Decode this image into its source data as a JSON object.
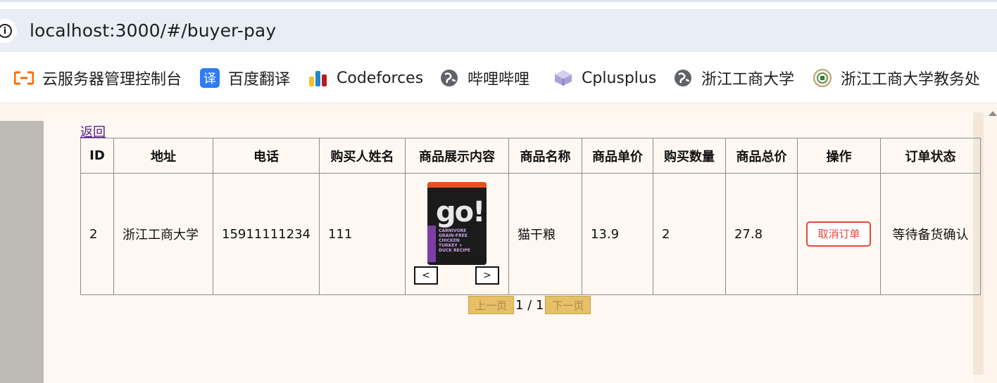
{
  "browser": {
    "url": "localhost:3000/#/buyer-pay",
    "bookmarks": [
      {
        "label": "云服务器管理控制台",
        "icon": "aliyun-icon"
      },
      {
        "label": "百度翻译",
        "icon": "translate-icon"
      },
      {
        "label": "Codeforces",
        "icon": "codeforces-icon"
      },
      {
        "label": "哔哩哔哩",
        "icon": "globe-icon"
      },
      {
        "label": "Cplusplus",
        "icon": "cplusplus-icon"
      },
      {
        "label": "浙江工商大学",
        "icon": "globe-icon"
      },
      {
        "label": "浙江工商大学教务处",
        "icon": "school-seal-icon"
      }
    ]
  },
  "page": {
    "back_label": "返回",
    "table": {
      "headers": [
        "ID",
        "地址",
        "电话",
        "购买人姓名",
        "商品展示内容",
        "商品名称",
        "商品单价",
        "购买数量",
        "商品总价",
        "操作",
        "订单状态"
      ],
      "rows": [
        {
          "id": "2",
          "address": "浙江工商大学",
          "phone": "15911111234",
          "buyer_name": "111",
          "image_prev": "<",
          "image_next": ">",
          "product_name": "猫干粮",
          "unit_price": "13.9",
          "quantity": "2",
          "total_price": "27.8",
          "action_label": "取消订单",
          "status": "等待备货确认"
        }
      ]
    },
    "pagination": {
      "prev_label": "上一页",
      "page_text": "1 / 1",
      "next_label": "下一页"
    },
    "product_image_text": {
      "logo": "go!",
      "line1": "CARNIVORE",
      "line2": "GRAIN-FREE",
      "line3": "CHICKEN",
      "line4": "TURKEY +",
      "line5": "DUCK RECIPE"
    }
  },
  "colors": {
    "cancel_accent": "#e04b3c",
    "pager_bg": "#e7c067",
    "page_bg": "#fff8f2"
  }
}
